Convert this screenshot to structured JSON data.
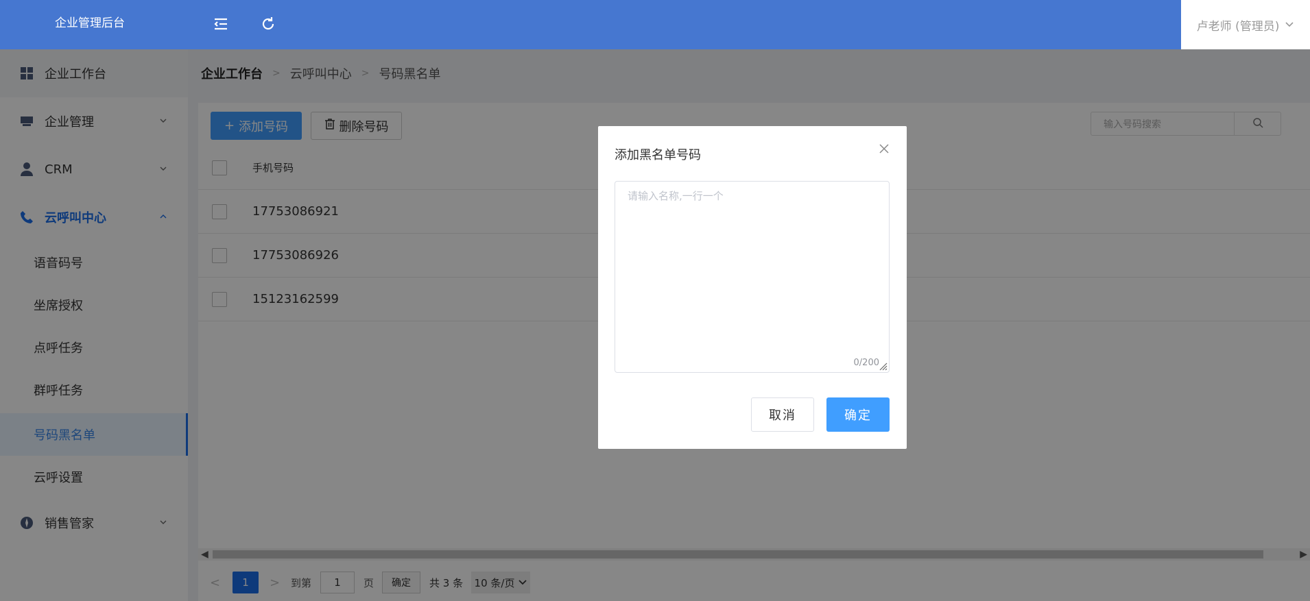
{
  "header": {
    "brand": "企业管理后台",
    "user_label": "卢老师 (管理员)"
  },
  "sidebar": {
    "items": [
      {
        "label": "企业工作台",
        "icon": "grid-icon"
      },
      {
        "label": "企业管理",
        "icon": "store-icon"
      },
      {
        "label": "CRM",
        "icon": "user-icon"
      },
      {
        "label": "云呼叫中心",
        "icon": "phone-icon",
        "expanded": true
      },
      {
        "label": "销售管家",
        "icon": "compass-icon"
      }
    ],
    "sub_items": [
      {
        "label": "语音码号"
      },
      {
        "label": "坐席授权"
      },
      {
        "label": "点呼任务"
      },
      {
        "label": "群呼任务"
      },
      {
        "label": "号码黑名单",
        "selected": true
      },
      {
        "label": "云呼设置"
      }
    ]
  },
  "breadcrumb": [
    "企业工作台",
    "云呼叫中心",
    "号码黑名单"
  ],
  "toolbar": {
    "add_label": "添加号码",
    "delete_label": "删除号码",
    "search_placeholder": "输入号码搜索"
  },
  "table": {
    "header": "手机号码",
    "rows": [
      "17753086921",
      "17753086926",
      "15123162599"
    ]
  },
  "pagination": {
    "current": "1",
    "goto_label": "到第",
    "goto_value": "1",
    "page_label": "页",
    "confirm_label": "确定",
    "total_label": "共 3 条",
    "page_size": "10 条/页"
  },
  "dialog": {
    "title": "添加黑名单号码",
    "placeholder": "请输入名称,一行一个",
    "counter": "0/200",
    "cancel_label": "取消",
    "ok_label": "确定"
  },
  "colors": {
    "header_bg": "#4677d0",
    "accent": "#1b6ee8",
    "primary_button": "#409eff"
  }
}
